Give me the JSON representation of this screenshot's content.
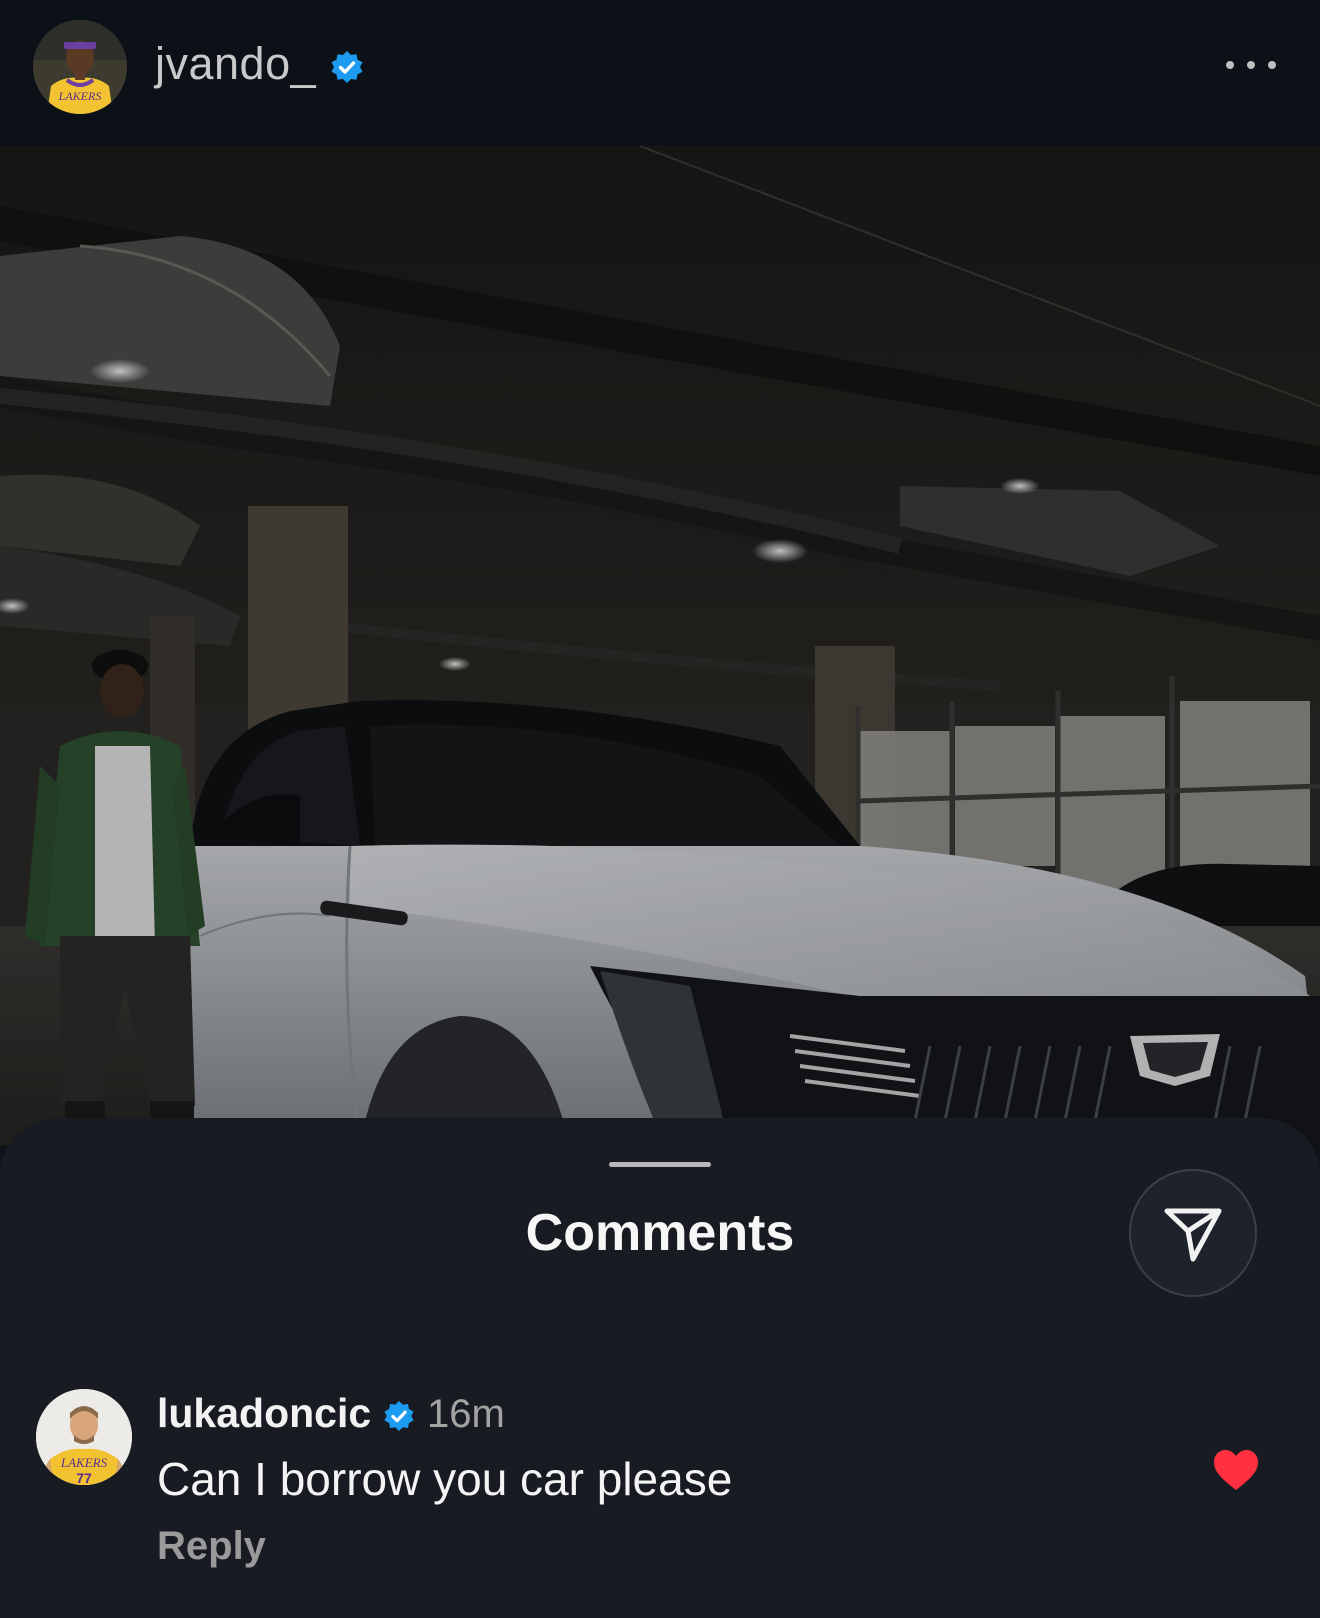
{
  "post": {
    "username": "jvando_",
    "verified": true,
    "more_icon": "ellipsis-icon"
  },
  "comments_sheet": {
    "title": "Comments",
    "share_icon": "send-icon"
  },
  "comment": {
    "username": "lukadoncic",
    "verified": true,
    "time": "16m",
    "text": "Can I borrow you car please",
    "reply_label": "Reply",
    "liked": true,
    "like_count": "",
    "like_color": "#ff3040"
  },
  "colors": {
    "verified": "#1d9bf0",
    "background": "#181c22"
  }
}
